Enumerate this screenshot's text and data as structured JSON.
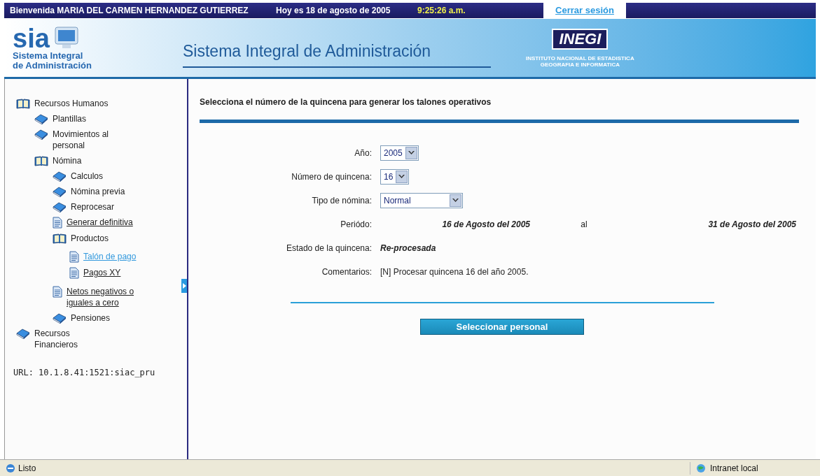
{
  "top_bar": {
    "welcome": "Bienvenida MARIA DEL CARMEN HERNANDEZ GUTIERREZ",
    "date": "Hoy es 18 de agosto de 2005",
    "time": "9:25:26 a.m.",
    "logout": "Cerrar sesión"
  },
  "header": {
    "logo_word": "sia",
    "logo_line1": "Sistema Integral",
    "logo_line2": "de Administración",
    "title": "Sistema Integral de Administración",
    "inegi_name": "INEGI",
    "inegi_line1": "INSTITUTO NACIONAL DE ESTADISTICA",
    "inegi_line2": "GEOGRAFIA E INFORMATICA"
  },
  "sidebar": {
    "tree": [
      {
        "label": "Recursos Humanos",
        "kind": "folder",
        "selected": false,
        "children": [
          {
            "label": "Plantillas",
            "kind": "book",
            "selected": false
          },
          {
            "label": "Movimientos al personal",
            "kind": "book",
            "selected": false
          },
          {
            "label": "Nómina",
            "kind": "folder",
            "selected": false,
            "children": [
              {
                "label": "Calculos",
                "kind": "book",
                "selected": false
              },
              {
                "label": "Nómina previa",
                "kind": "book",
                "selected": false
              },
              {
                "label": "Reprocesar",
                "kind": "book",
                "selected": false
              },
              {
                "label": "Generar definitiva",
                "kind": "page",
                "selected": false
              },
              {
                "label": "Productos",
                "kind": "folder",
                "selected": false,
                "children": [
                  {
                    "label": "Talón de pago",
                    "kind": "page",
                    "selected": true
                  },
                  {
                    "label": "Pagos XY",
                    "kind": "page",
                    "selected": false
                  }
                ]
              },
              {
                "label": "Netos negativos o iguales a cero",
                "kind": "page",
                "selected": false
              },
              {
                "label": "Pensiones",
                "kind": "book",
                "selected": false
              }
            ]
          }
        ]
      },
      {
        "label": "Recursos Financieros",
        "kind": "book",
        "selected": false
      }
    ],
    "url": "URL: 10.1.8.41:1521:siac_pru"
  },
  "main": {
    "heading": "Selecciona el número de la quincena para generar los talones operativos",
    "fields": [
      {
        "label": "Año:",
        "kind": "select",
        "value": "2005"
      },
      {
        "label": "Número de quincena:",
        "kind": "select",
        "value": "16"
      },
      {
        "label": "Tipo de nómina:",
        "kind": "select",
        "value": "Normal"
      },
      {
        "label": "Periódo:",
        "kind": "period",
        "from": "16 de Agosto del 2005",
        "joiner": "al",
        "to": "31 de Agosto del 2005"
      },
      {
        "label": "Estado de la quincena:",
        "kind": "status",
        "value": "Re-procesada"
      },
      {
        "label": "Comentarios:",
        "kind": "text",
        "value": "[N] Procesar quincena 16 del año 2005."
      }
    ],
    "button": "Seleccionar personal"
  },
  "status_bar": {
    "text": "Listo",
    "zone": "Intranet local"
  }
}
